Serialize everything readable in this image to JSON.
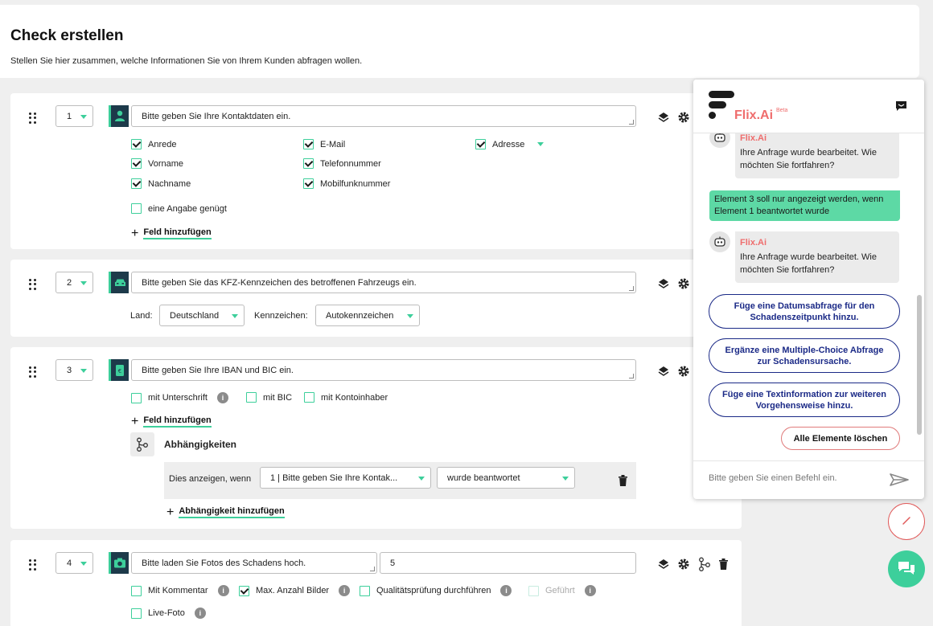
{
  "header": {
    "title": "Check erstellen",
    "subtitle": "Stellen Sie hier zusammen, welche Informationen Sie von Ihrem Kunden abfragen wollen."
  },
  "card1": {
    "number": "1",
    "question": "Bitte geben Sie Ihre Kontaktdaten ein.",
    "fields": [
      {
        "label": "Anrede",
        "checked": true
      },
      {
        "label": "E-Mail",
        "checked": true
      },
      {
        "label": "Adresse",
        "checked": true
      },
      {
        "label": "Vorname",
        "checked": true
      },
      {
        "label": "Telefonnummer",
        "checked": true
      },
      {
        "label": "Nachname",
        "checked": true
      },
      {
        "label": "Mobilfunknummer",
        "checked": true
      }
    ],
    "one_suffices": "eine Angabe genügt",
    "add_field": "Feld hinzufügen"
  },
  "card2": {
    "number": "2",
    "question": "Bitte geben Sie das KFZ-Kennzeichen des betroffenen Fahrzeugs ein.",
    "land_label": "Land:",
    "land_value": "Deutschland",
    "plate_label": "Kennzeichen:",
    "plate_value": "Autokennzeichen"
  },
  "card3": {
    "number": "3",
    "question": "Bitte geben Sie Ihre IBAN und BIC ein.",
    "options": [
      "mit Unterschrift",
      "mit BIC",
      "mit Kontoinhaber"
    ],
    "add_field": "Feld hinzufügen",
    "dependencies_title": "Abhängigkeiten",
    "dep_label": "Dies anzeigen, wenn",
    "dep_element": "1 | Bitte geben Sie Ihre Kontak...",
    "dep_condition": "wurde beantwortet",
    "add_dependency": "Abhängigkeit hinzufügen"
  },
  "card4": {
    "number": "4",
    "question": "Bitte laden Sie Fotos des Schadens hoch.",
    "count": "5",
    "options": [
      {
        "label": "Mit Kommentar",
        "checked": false
      },
      {
        "label": "Max. Anzahl Bilder",
        "checked": true
      },
      {
        "label": "Qualitätsprüfung durchführen",
        "checked": false
      },
      {
        "label": "Geführt",
        "checked": false,
        "disabled": true
      },
      {
        "label": "Live-Foto",
        "checked": false
      }
    ]
  },
  "assistant": {
    "brand": "Flix.Ai",
    "beta": "Beta",
    "messages": [
      {
        "from": "bot",
        "name": "Flix.Ai",
        "text": "Ihre Anfrage wurde bearbeitet. Wie möchten Sie fortfahren?"
      },
      {
        "from": "user",
        "text": "Element 3 soll nur angezeigt werden, wenn Element 1 beantwortet wurde"
      },
      {
        "from": "bot",
        "name": "Flix.Ai",
        "text": "Ihre Anfrage wurde bearbeitet. Wie möchten Sie fortfahren?"
      }
    ],
    "suggestions": [
      "Füge eine Datumsabfrage für den Schadenszeitpunkt hinzu.",
      "Ergänze eine Multiple-Choice Abfrage zur Schadensursache.",
      "Füge eine Textinformation zur weiteren Vorgehensweise hinzu."
    ],
    "delete_all": "Alle Elemente löschen",
    "input_placeholder": "Bitte geben Sie einen Befehl ein."
  },
  "colors": {
    "accent": "#3dcf9b",
    "brand": "#ef6d6d",
    "suggestion": "#1b2a87",
    "icon_bg": "#1d3a4a"
  }
}
